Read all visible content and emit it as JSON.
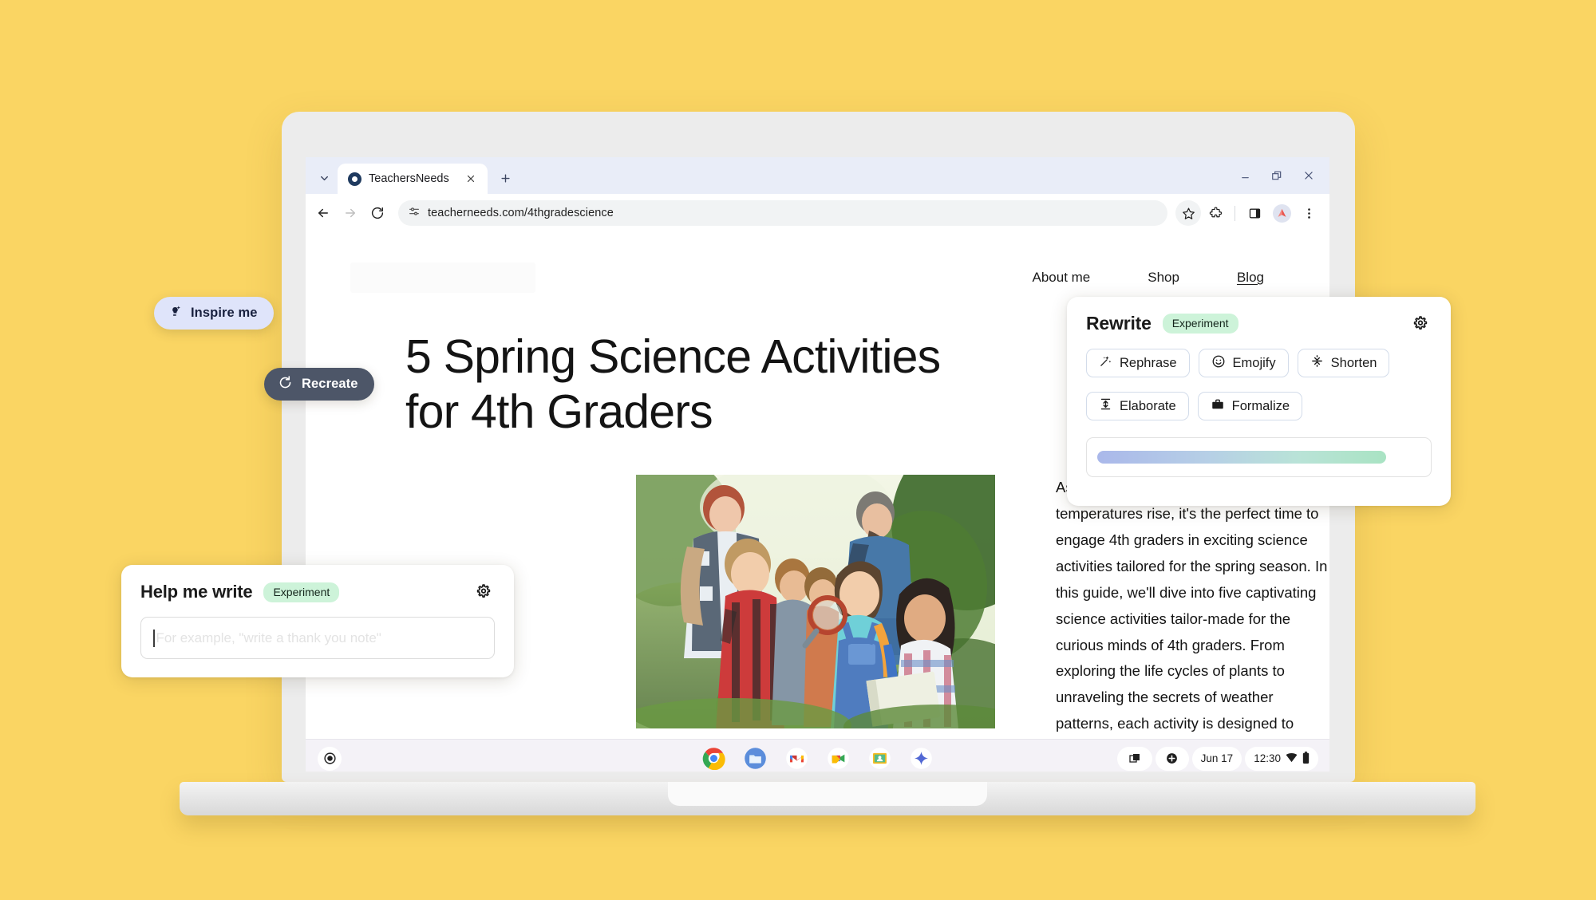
{
  "theme": {
    "background": "#FAD563",
    "badge_green": "#CDF3D9",
    "pill_lavender": "#DFE4FA",
    "pill_slate": "#4D5668"
  },
  "browser": {
    "tab": {
      "title": "TeachersNeeds",
      "favicon": "chrome-globe-icon",
      "close_icon": "close-icon"
    },
    "tab_list_icon": "chevron-down-icon",
    "new_tab_icon": "plus-icon",
    "window_controls": {
      "minimize": "minimize-icon",
      "restore": "restore-icon",
      "close": "close-icon"
    },
    "toolbar": {
      "back_icon": "back-arrow-icon",
      "forward_icon": "forward-arrow-icon",
      "reload_icon": "reload-icon",
      "site_info_icon": "tune-site-settings-icon",
      "url": "teacherneeds.com/4thgradescience",
      "bookmark_icon": "star-icon",
      "extensions_icon": "puzzle-piece-icon",
      "side_panel_icon": "side-panel-icon",
      "profile_icon": "profile-avatar",
      "menu_icon": "three-dot-menu-icon"
    }
  },
  "webpage": {
    "logo_alt": "site-logo-placeholder",
    "nav": [
      {
        "label": "About me",
        "active": false
      },
      {
        "label": "Shop",
        "active": false
      },
      {
        "label": "Blog",
        "active": true
      }
    ],
    "title": "5 Spring Science Activities for 4th Graders",
    "hero_image_alt": "children-exploring-nature-with-magnifying-glass-and-notebook",
    "body": "As the days grow longer and the temperatures rise, it's the perfect time to engage 4th graders in exciting science activities tailored for the spring season. In this guide, we'll dive into five captivating science activities tailor-made for the curious minds of 4th graders. From exploring the life cycles of plants to unraveling the secrets of weather patterns, each activity is designed to spark curiosity, inspire wonder, and ignite a lifelong passion for scientific exploration."
  },
  "help_me_write": {
    "title": "Help me write",
    "badge": "Experiment",
    "settings_icon": "gear-icon",
    "input_value": "",
    "input_placeholder": "For example, \"write a thank you note\""
  },
  "rewrite": {
    "title": "Rewrite",
    "badge": "Experiment",
    "settings_icon": "gear-icon",
    "chips_row_1": [
      {
        "label": "Rephrase",
        "icon": "magic-wand-icon"
      },
      {
        "label": "Emojify",
        "icon": "smiley-face-icon"
      },
      {
        "label": "Shorten",
        "icon": "shorten-arrows-icon"
      }
    ],
    "chips_row_2": [
      {
        "label": "Elaborate",
        "icon": "expand-arrows-icon"
      },
      {
        "label": "Formalize",
        "icon": "briefcase-icon"
      }
    ],
    "progress_label": "generating-result-progress"
  },
  "floating_actions": [
    {
      "label": "Inspire me",
      "icon": "lightbulb-sparkle-icon",
      "style": "lavender"
    },
    {
      "label": "Recreate",
      "icon": "refresh-icon",
      "style": "slate"
    }
  ],
  "shelf": {
    "launcher_icon": "launcher-circle-icon",
    "apps": [
      {
        "name": "chrome-app-icon",
        "label": "Chrome",
        "active": true
      },
      {
        "name": "files-app-icon",
        "label": "Files",
        "active": false
      },
      {
        "name": "gmail-app-icon",
        "label": "Gmail",
        "active": false
      },
      {
        "name": "google-meet-app-icon",
        "label": "Google Meet",
        "active": false
      },
      {
        "name": "google-classroom-app-icon",
        "label": "Google Classroom",
        "active": false
      },
      {
        "name": "gemini-app-icon",
        "label": "Gemini",
        "active": false
      }
    ],
    "status": {
      "overview_icon": "window-overview-icon",
      "add_icon": "plus-circle-icon",
      "date": "Jun 17",
      "time": "12:30",
      "wifi_icon": "wifi-icon",
      "battery_icon": "battery-icon"
    }
  }
}
